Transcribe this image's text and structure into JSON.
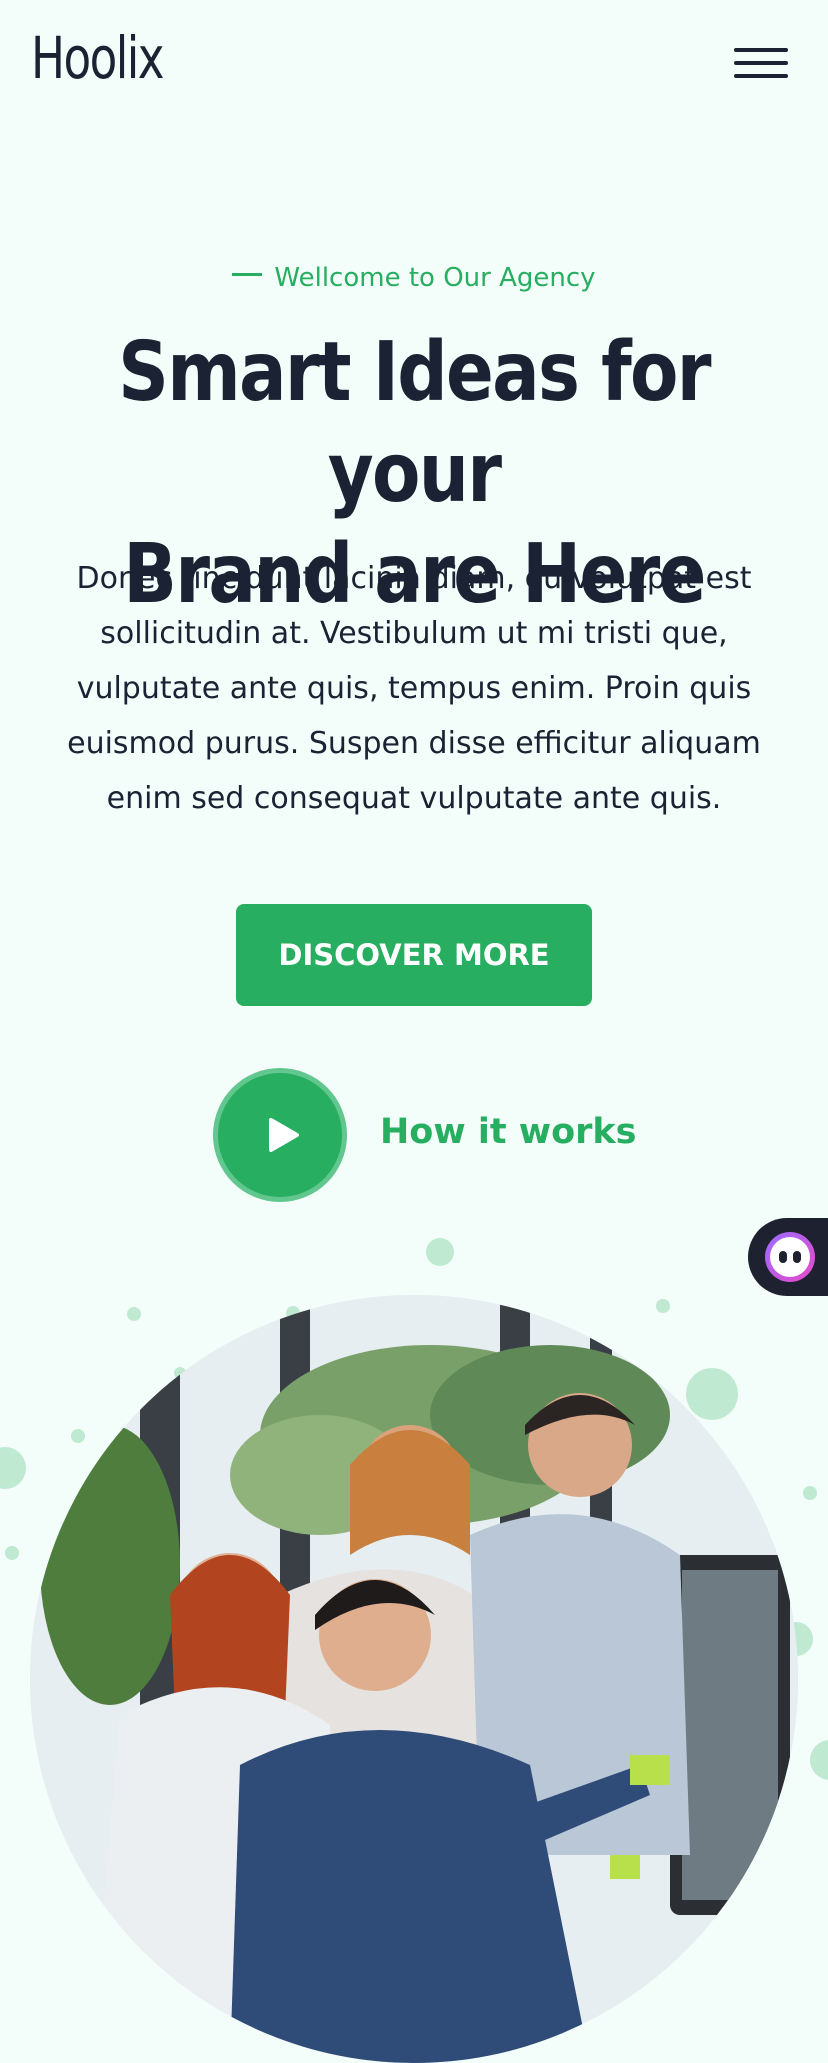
{
  "header": {
    "logo_text": "Hoolix",
    "menu_icon": "hamburger-icon"
  },
  "hero": {
    "eyebrow": "Wellcome to Our Agency",
    "headline_line1": "Smart Ideas for your",
    "headline_line2": "Brand are Here",
    "intro": "Donec tincidunt lacinia diam, eu volutpat est sollicitudin at. Vestibulum ut mi tristi que, vulputate ante quis, tempus enim. Proin quis euismod purus. Suspen disse efficitur aliquam enim sed consequat vulputate ante quis.",
    "cta_label": "DISCOVER MORE",
    "video_label": "How it works",
    "video_icon": "play-icon"
  },
  "chat_widget": {
    "icon": "chat-assistant-icon"
  },
  "theme": {
    "accent": "#27ae60",
    "background": "#f3fdf9",
    "text": "#1a2233"
  }
}
